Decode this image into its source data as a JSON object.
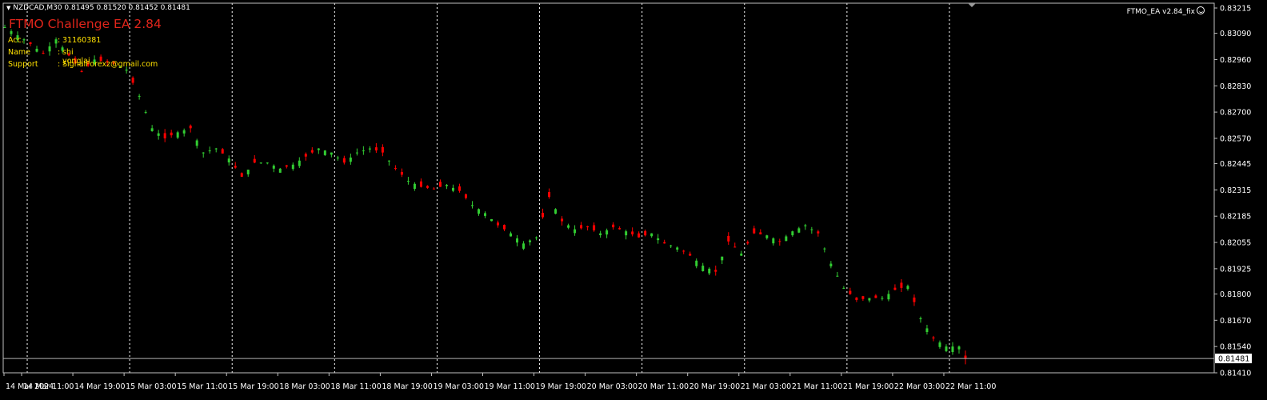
{
  "symbol_line": "NZDCAD,M30  0.81495 0.81520 0.81452 0.81481",
  "ea_overlay": {
    "title": "FTMO Challenge EA 2.84",
    "rows": [
      {
        "key": "Acc.",
        "value": "31160381"
      },
      {
        "key": "Name",
        "value": "shi yonglai"
      },
      {
        "key": "Support",
        "value": "SignalForexz@gmail.com"
      }
    ],
    "ea_label": "FTMO_EA  v2.84_fix",
    "ea_icon": "smiley-icon"
  },
  "colors": {
    "background": "#000000",
    "bull": "#32cd32",
    "bear": "#ff0000",
    "text": "#ffffff",
    "grid": "#ffffff",
    "axis": "#c0c0c0",
    "info": "#ffe000",
    "title": "#e0251b",
    "current_price_box": "#ffffff"
  },
  "chart_data": {
    "type": "candlestick",
    "symbol": "NZDCAD",
    "timeframe": "M30",
    "ohlc_last": {
      "open": 0.81495,
      "high": 0.8152,
      "low": 0.81452,
      "close": 0.81481
    },
    "current_price": 0.81481,
    "current_price_label": "0.81481",
    "ylim": [
      0.8141,
      0.83215
    ],
    "y_ticks": [
      "0.83215",
      "0.83090",
      "0.82960",
      "0.82830",
      "0.82700",
      "0.82570",
      "0.82445",
      "0.82315",
      "0.82185",
      "0.82055",
      "0.81925",
      "0.81800",
      "0.81670",
      "0.81540",
      "0.81410"
    ],
    "x_ticks": [
      "14 Mar 2024",
      "14 Mar 11:00",
      "14 Mar 19:00",
      "15 Mar 03:00",
      "15 Mar 11:00",
      "15 Mar 19:00",
      "18 Mar 03:00",
      "18 Mar 11:00",
      "18 Mar 19:00",
      "19 Mar 03:00",
      "19 Mar 11:00",
      "19 Mar 19:00",
      "20 Mar 03:00",
      "20 Mar 11:00",
      "20 Mar 19:00",
      "21 Mar 03:00",
      "21 Mar 11:00",
      "21 Mar 19:00",
      "22 Mar 03:00",
      "22 Mar 11:00"
    ],
    "day_separators": [
      3,
      19,
      35,
      51,
      67,
      83,
      99,
      115,
      131,
      147
    ],
    "grid": "vertical-dotted",
    "close_path": [
      [
        0,
        0.8312
      ],
      [
        3,
        0.8306
      ],
      [
        6,
        0.8299
      ],
      [
        8,
        0.8306
      ],
      [
        10,
        0.8298
      ],
      [
        12,
        0.829
      ],
      [
        14,
        0.8296
      ],
      [
        17,
        0.8294
      ],
      [
        19,
        0.8291
      ],
      [
        21,
        0.8278
      ],
      [
        23,
        0.8262
      ],
      [
        25,
        0.8257
      ],
      [
        27,
        0.826
      ],
      [
        29,
        0.8262
      ],
      [
        31,
        0.825
      ],
      [
        33,
        0.8252
      ],
      [
        35,
        0.8247
      ],
      [
        37,
        0.8238
      ],
      [
        39,
        0.8245
      ],
      [
        41,
        0.8245
      ],
      [
        43,
        0.8242
      ],
      [
        45,
        0.8244
      ],
      [
        47,
        0.8248
      ],
      [
        49,
        0.8252
      ],
      [
        51,
        0.825
      ],
      [
        53,
        0.8245
      ],
      [
        55,
        0.825
      ],
      [
        57,
        0.8252
      ],
      [
        59,
        0.825
      ],
      [
        61,
        0.8242
      ],
      [
        63,
        0.8236
      ],
      [
        65,
        0.8233
      ],
      [
        67,
        0.8232
      ],
      [
        69,
        0.8234
      ],
      [
        71,
        0.8231
      ],
      [
        73,
        0.8224
      ],
      [
        75,
        0.822
      ],
      [
        77,
        0.8214
      ],
      [
        79,
        0.821
      ],
      [
        81,
        0.8205
      ],
      [
        83,
        0.8208
      ],
      [
        85,
        0.8228
      ],
      [
        87,
        0.8216
      ],
      [
        89,
        0.8212
      ],
      [
        91,
        0.8213
      ],
      [
        93,
        0.821
      ],
      [
        95,
        0.8213
      ],
      [
        97,
        0.8211
      ],
      [
        99,
        0.8208
      ],
      [
        101,
        0.821
      ],
      [
        103,
        0.8205
      ],
      [
        105,
        0.8203
      ],
      [
        107,
        0.8199
      ],
      [
        109,
        0.8194
      ],
      [
        111,
        0.8191
      ],
      [
        113,
        0.8206
      ],
      [
        115,
        0.82
      ],
      [
        117,
        0.821
      ],
      [
        119,
        0.8209
      ],
      [
        121,
        0.8206
      ],
      [
        123,
        0.8211
      ],
      [
        125,
        0.8214
      ],
      [
        127,
        0.821
      ],
      [
        129,
        0.8195
      ],
      [
        131,
        0.8183
      ],
      [
        133,
        0.8177
      ],
      [
        135,
        0.8178
      ],
      [
        137,
        0.8178
      ],
      [
        139,
        0.8182
      ],
      [
        141,
        0.8184
      ],
      [
        143,
        0.8168
      ],
      [
        145,
        0.8158
      ],
      [
        147,
        0.8154
      ],
      [
        149,
        0.8154
      ],
      [
        150,
        0.81481
      ]
    ],
    "candles_shown": 151
  }
}
